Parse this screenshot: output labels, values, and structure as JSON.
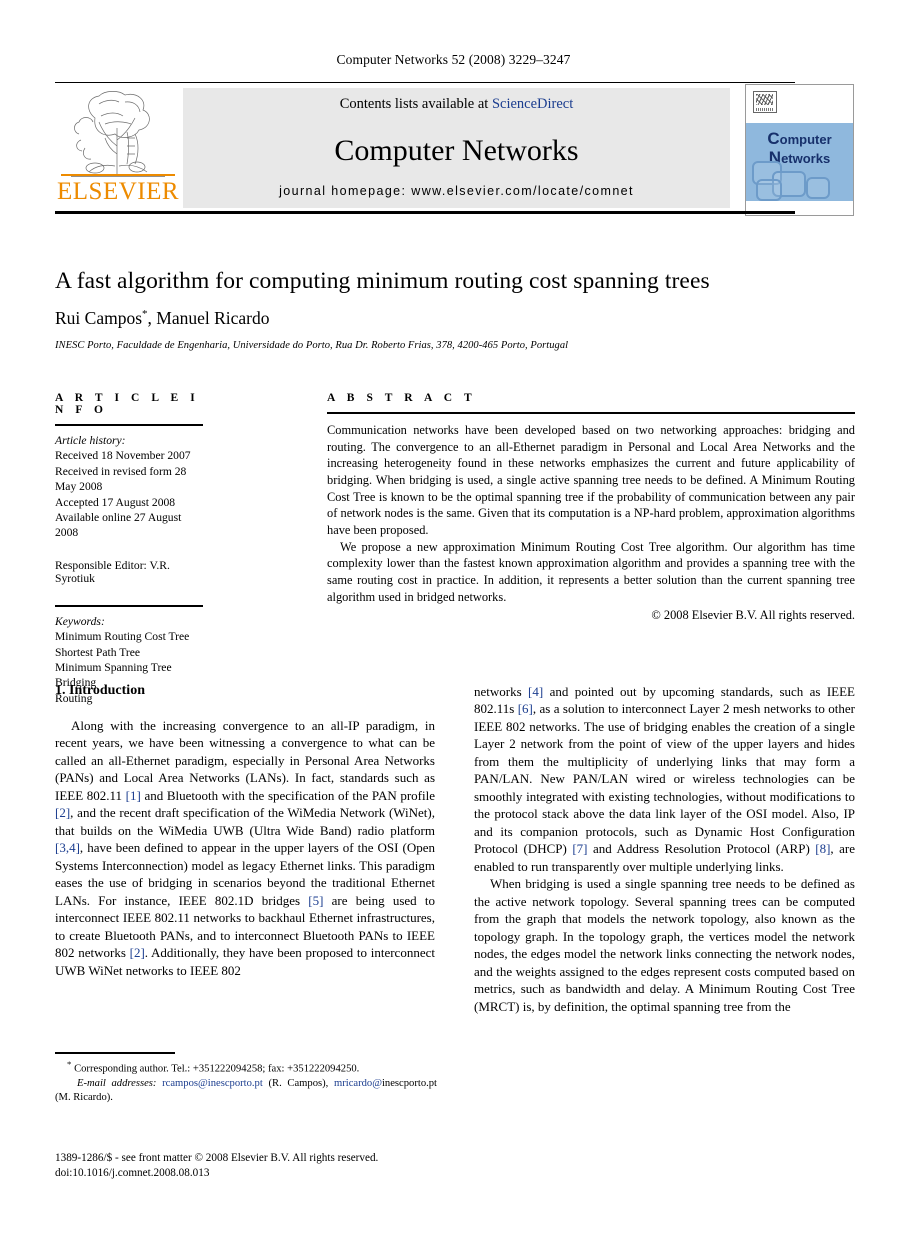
{
  "running_head": "Computer Networks 52 (2008) 3229–3247",
  "masthead": {
    "contents_prefix": "Contents lists available at ",
    "contents_link": "ScienceDirect",
    "journal_title": "Computer Networks",
    "homepage_label": "journal homepage: www.elsevier.com/locate/comnet",
    "publisher_name": "ELSEVIER",
    "cover_title_line1_a": "C",
    "cover_title_line1_b": "om",
    "cover_title_line1_c": "puter",
    "cover_title_line2_a": "N",
    "cover_title_line2_b": "et",
    "cover_title_line2_c": "works",
    "link_color": "#1b3d8f",
    "elsevier_orange": "#ED8B00",
    "cover_band_color": "#8fb8dd"
  },
  "article": {
    "title": "A fast algorithm for computing minimum routing cost spanning trees",
    "authors": "Rui Campos",
    "corresponding_marker": "*",
    "authors_rest": ", Manuel Ricardo",
    "affiliation": "INESC Porto, Faculdade de Engenharia, Universidade do Porto, Rua Dr. Roberto Frias, 378, 4200-465 Porto, Portugal"
  },
  "article_info": {
    "heading": "A R T I C L E   I N F O",
    "history_label": "Article history:",
    "history": [
      "Received 18 November 2007",
      "Received in revised form 28 May 2008",
      "Accepted 17 August 2008",
      "Available online 27 August 2008"
    ],
    "responsible_editor": "Responsible Editor: V.R. Syrotiuk",
    "keywords_label": "Keywords:",
    "keywords": [
      "Minimum Routing Cost Tree",
      "Shortest Path Tree",
      "Minimum Spanning Tree",
      "Bridging",
      "Routing"
    ]
  },
  "abstract": {
    "heading": "A B S T R A C T",
    "paragraph_1": "Communication networks have been developed based on two networking approaches: bridging and routing. The convergence to an all-Ethernet paradigm in Personal and Local Area Networks and the increasing heterogeneity found in these networks emphasizes the current and future applicability of bridging. When bridging is used, a single active spanning tree needs to be defined. A Minimum Routing Cost Tree is known to be the optimal spanning tree if the probability of communication between any pair of network nodes is the same. Given that its computation is a NP-hard problem, approximation algorithms have been proposed.",
    "paragraph_2": "We propose a new approximation Minimum Routing Cost Tree algorithm. Our algorithm has time complexity lower than the fastest known approximation algorithm and provides a spanning tree with the same routing cost in practice. In addition, it represents a better solution than the current spanning tree algorithm used in bridged networks.",
    "copyright": "© 2008 Elsevier B.V. All rights reserved."
  },
  "body": {
    "section_1_heading": "1. Introduction",
    "left_p1_a": "Along with the increasing convergence to an all-IP paradigm, in recent years, we have been witnessing a convergence to what can be called an all-Ethernet paradigm, especially in Personal Area Networks (PANs) and Local Area Networks (LANs). In fact, standards such as IEEE 802.11 ",
    "left_ref1": "[1]",
    "left_p1_b": " and Bluetooth with the specification of the PAN profile ",
    "left_ref2": "[2]",
    "left_p1_c": ", and the recent draft specification of the WiMedia Network (WiNet), that builds on the WiMedia UWB (Ultra Wide Band) radio platform ",
    "left_ref3": "[3,4]",
    "left_p1_d": ", have been defined to appear in the upper layers of the OSI (Open Systems Interconnection) model as legacy Ethernet links. This paradigm eases the use of bridging in scenarios beyond the traditional Ethernet LANs. For instance, IEEE 802.1D bridges ",
    "left_ref4": "[5]",
    "left_p1_e": " are being used to interconnect IEEE 802.11 networks to backhaul Ethernet infrastructures, to create Bluetooth PANs, and to interconnect Bluetooth PANs to IEEE 802 networks ",
    "left_ref5": "[2]",
    "left_p1_f": ". Additionally, they have been proposed to interconnect UWB WiNet networks to IEEE 802",
    "right_p1_a": "networks ",
    "right_ref1": "[4]",
    "right_p1_b": " and pointed out by upcoming standards, such as IEEE 802.11s ",
    "right_ref2": "[6]",
    "right_p1_c": ", as a solution to interconnect Layer 2 mesh networks to other IEEE 802 networks. The use of bridging enables the creation of a single Layer 2 network from the point of view of the upper layers and hides from them the multiplicity of underlying links that may form a PAN/LAN. New PAN/LAN wired or wireless technologies can be smoothly integrated with existing technologies, without modifications to the protocol stack above the data link layer of the OSI model. Also, IP and its companion protocols, such as Dynamic Host Configuration Protocol (DHCP) ",
    "right_ref3": "[7]",
    "right_p1_d": " and Address Resolution Protocol (ARP) ",
    "right_ref4": "[8]",
    "right_p1_e": ", are enabled to run transparently over multiple underlying links.",
    "right_p2": "When bridging is used a single spanning tree needs to be defined as the active network topology. Several spanning trees can be computed from the graph that models the network topology, also known as the topology graph. In the topology graph, the vertices model the network nodes, the edges model the network links connecting the network nodes, and the weights assigned to the edges represent costs computed based on metrics, such as bandwidth and delay. A Minimum Routing Cost Tree (MRCT) is, by definition, the optimal spanning tree from the"
  },
  "footnotes": {
    "corresponding_marker": "*",
    "corresponding": " Corresponding author. Tel.: +351222094258; fax: +351222094250.",
    "email_label": "E-mail addresses:",
    "email_1": "rcampos@inescporto.pt",
    "email_1_name": " (R. Campos), ",
    "email_2": "mricardo@",
    "email_2_cont": "inescporto.pt",
    "email_2_name": " (M. Ricardo)."
  },
  "imprint": {
    "line_1": "1389-1286/$ - see front matter © 2008 Elsevier B.V. All rights reserved.",
    "line_2": "doi:10.1016/j.comnet.2008.08.013"
  }
}
